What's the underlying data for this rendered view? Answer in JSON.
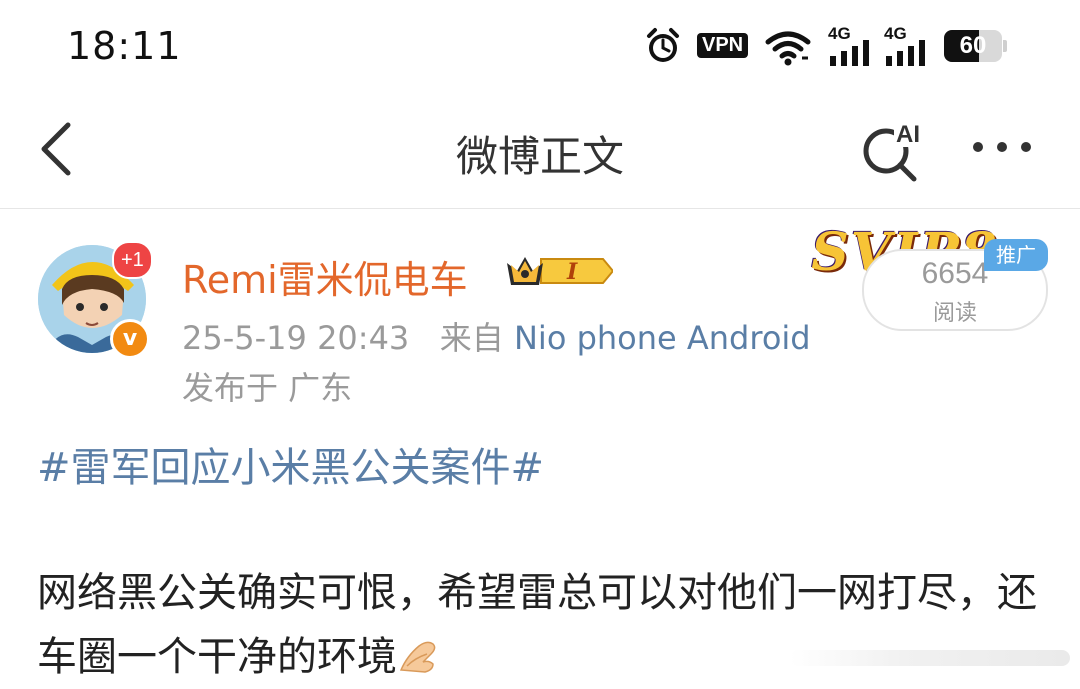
{
  "status_bar": {
    "time": "18:11",
    "vpn_label": "VPN",
    "network_labels": [
      "4G",
      "4G"
    ],
    "battery_level": "60",
    "battery_fraction": 0.6
  },
  "nav": {
    "title": "微博正文",
    "ai_label": "AI",
    "icons": [
      "back-chevron-icon",
      "ai-search-icon",
      "more-dots-icon"
    ]
  },
  "post": {
    "author": "Remi雷米侃电车",
    "badge_count": "+1",
    "verified_mark": "v",
    "crown_level": "I",
    "date": "25-5-19 20:43",
    "source_prefix": "来自",
    "source": "Nio phone Android",
    "location": "发布于 广东",
    "promo": {
      "graphic_text": "SVIP8",
      "ad_tag": "推广",
      "read_count": "6654",
      "read_label": "阅读"
    },
    "hashtag": "#雷军回应小米黑公关案件#",
    "body": "网络黑公关确实可恨，希望雷总可以对他们一网打尽，还车圈一个干净的环境",
    "emoji": "folded-hands-emoji"
  },
  "colors": {
    "username": "#e3672b",
    "link": "#5a7ea6",
    "meta": "#9a9a9a",
    "badge_red": "#ee4444",
    "verified_orange": "#f28a11",
    "ad_blue": "#5aa8e6"
  }
}
